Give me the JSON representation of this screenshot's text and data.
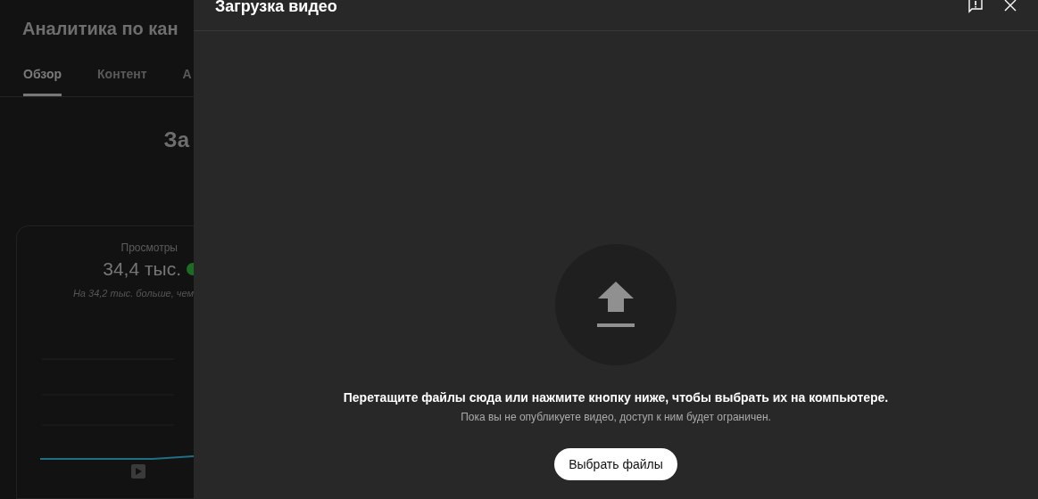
{
  "background": {
    "title": "Аналитика по кан",
    "tabs": [
      {
        "label": "Обзор",
        "selected": true
      },
      {
        "label": "Контент",
        "selected": false
      },
      {
        "label": "А",
        "selected": false
      }
    ],
    "heading": "За",
    "card": {
      "label": "Просмотры",
      "value": "34,4 тыс.",
      "note": "На 34,2 тыс. больше, чем"
    }
  },
  "dialog": {
    "title": "Загрузка видео",
    "drop_text": "Перетащите файлы сюда или нажмите кнопку ниже, чтобы выбрать их на компьютере.",
    "note": "Пока вы не опубликуете видео, доступ к ним будет ограничен.",
    "button": "Выбрать файлы"
  }
}
